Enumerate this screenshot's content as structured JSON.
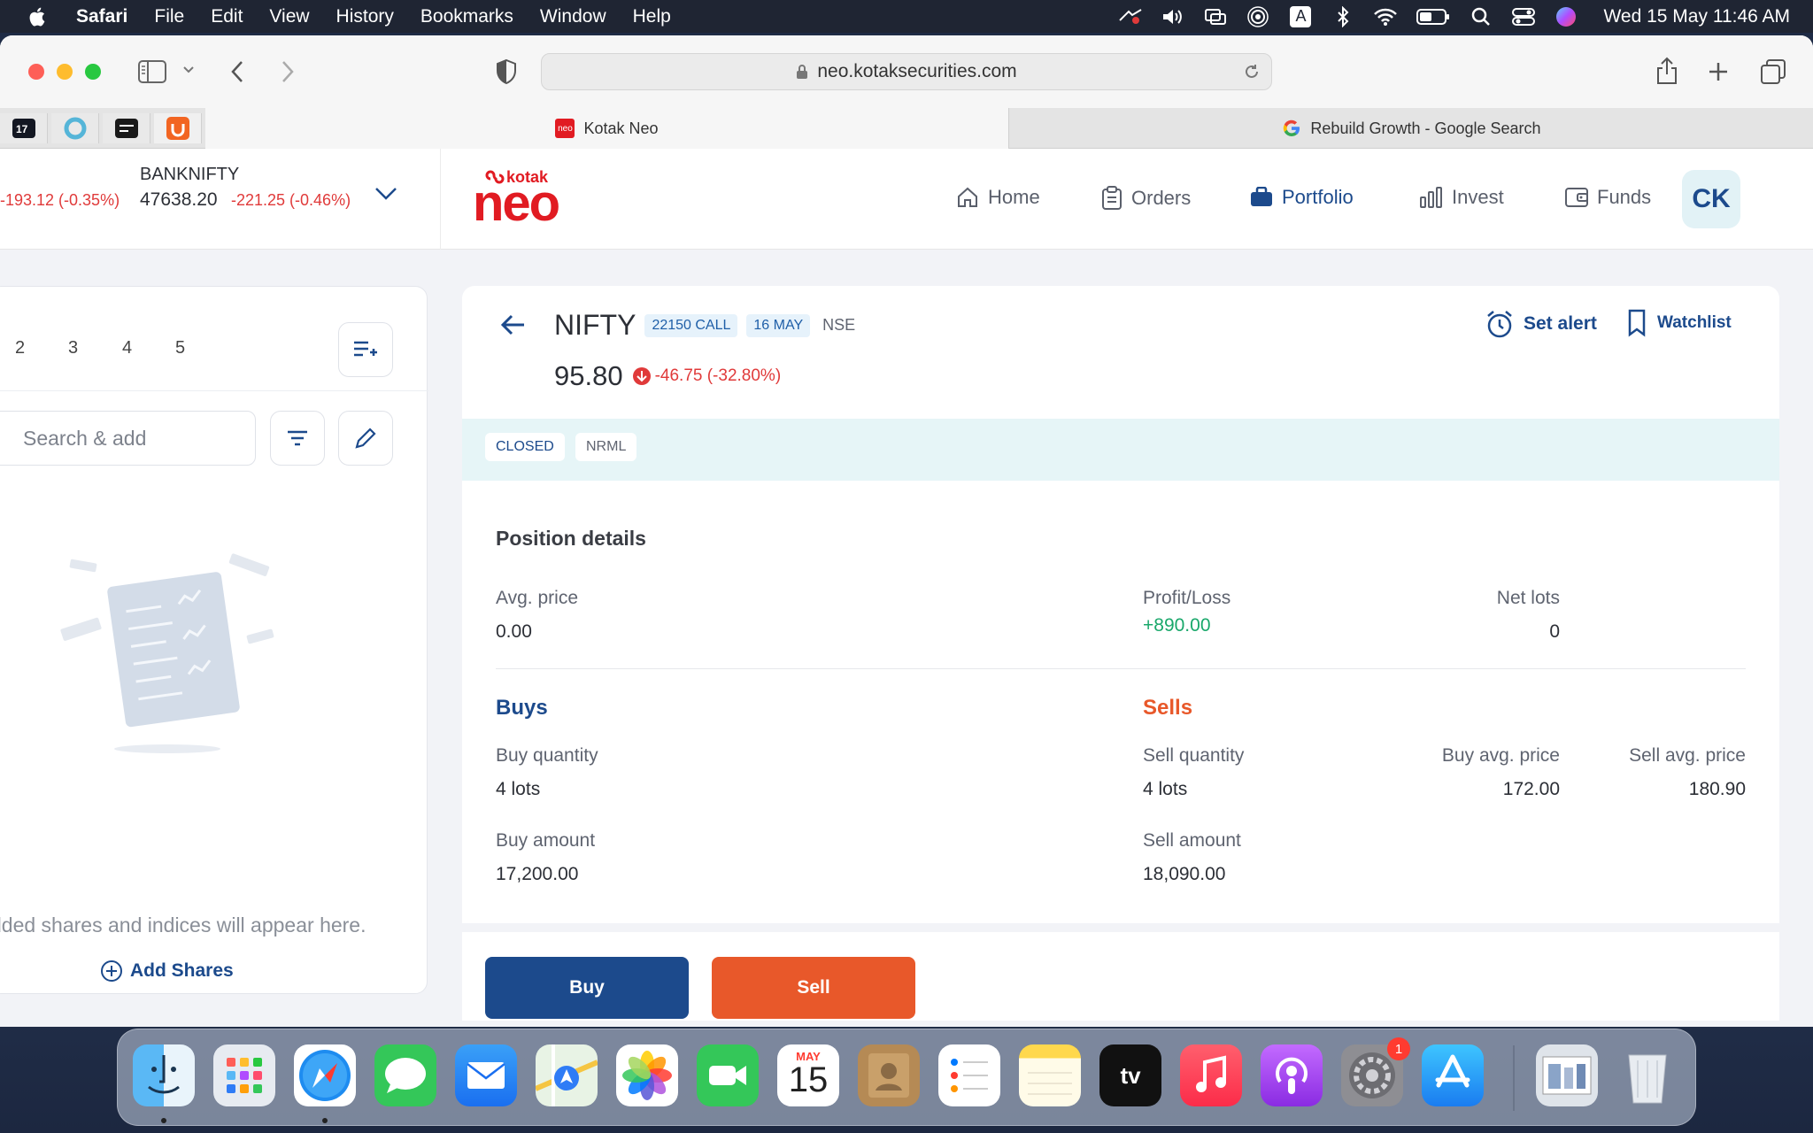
{
  "menubar": {
    "app_name": "Safari",
    "items": [
      "File",
      "Edit",
      "View",
      "History",
      "Bookmarks",
      "Window",
      "Help"
    ],
    "clock": "Wed 15 May  11:46 AM",
    "keyboard_indicator": "A"
  },
  "browser": {
    "url": "neo.kotaksecurities.com",
    "tabs": [
      {
        "title": "Kotak Neo",
        "active": true
      },
      {
        "title": "Rebuild Growth - Google Search",
        "active": false
      }
    ]
  },
  "ticker": {
    "partial_change": "-193.12 (-0.35%)",
    "banknifty": {
      "name": "BANKNIFTY",
      "value": "47638.20",
      "change": "-221.25 (-0.46%)"
    }
  },
  "brand": {
    "top": "kotak",
    "main": "neo"
  },
  "nav": {
    "items": [
      {
        "label": "Home",
        "icon": "home-icon"
      },
      {
        "label": "Orders",
        "icon": "clipboard-icon"
      },
      {
        "label": "Portfolio",
        "icon": "briefcase-icon",
        "active": true
      },
      {
        "label": "Invest",
        "icon": "bar-chart-icon"
      },
      {
        "label": "Funds",
        "icon": "wallet-icon"
      }
    ],
    "avatar_initials": "CK"
  },
  "watchlist": {
    "tabs": [
      "2",
      "3",
      "4",
      "5"
    ],
    "search_placeholder": "Search & add",
    "empty_message": "dded shares and indices will appear here.",
    "add_label": "Add Shares"
  },
  "instrument": {
    "name": "NIFTY",
    "strike_tag": "22150 CALL",
    "expiry_tag": "16 MAY",
    "exchange": "NSE",
    "price": "95.80",
    "change": "-46.75 (-32.80%)",
    "set_alert": "Set alert",
    "watchlist": "Watchlist",
    "status_tags": [
      "CLOSED",
      "NRML"
    ]
  },
  "position": {
    "title": "Position details",
    "avg_price_label": "Avg. price",
    "avg_price": "0.00",
    "net_lots_label": "Net lots",
    "net_lots": "0",
    "pl_label": "Profit/Loss",
    "pl": "+890.00",
    "buys_title": "Buys",
    "buy_qty_label": "Buy quantity",
    "buy_qty": "4 lots",
    "buy_avg_label": "Buy avg. price",
    "buy_avg": "172.00",
    "buy_amount_label": "Buy amount",
    "buy_amount": "17,200.00",
    "sells_title": "Sells",
    "sell_qty_label": "Sell quantity",
    "sell_qty": "4 lots",
    "sell_avg_label": "Sell avg. price",
    "sell_avg": "180.90",
    "sell_amount_label": "Sell amount",
    "sell_amount": "18,090.00"
  },
  "actions": {
    "buy": "Buy",
    "sell": "Sell"
  },
  "dock": {
    "calendar_month": "MAY",
    "calendar_day": "15",
    "settings_badge": "1",
    "tv_label": "tv"
  },
  "colors": {
    "brand_navy": "#1c4a8c",
    "brand_red": "#e11b22",
    "loss_red": "#e03a3a",
    "profit_green": "#1aa86b",
    "sell_orange": "#e8582a"
  }
}
